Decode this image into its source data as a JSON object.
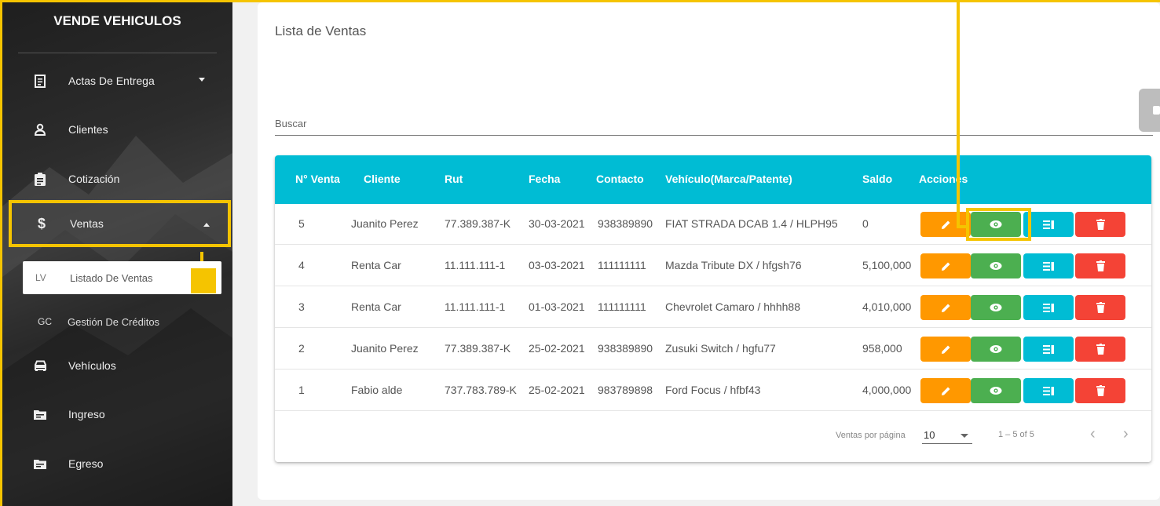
{
  "sidebar": {
    "brand": "VENDE VEHICULOS",
    "items": [
      {
        "label": "Actas De Entrega",
        "icon": "document-icon"
      },
      {
        "label": "Clientes",
        "icon": "person-icon"
      },
      {
        "label": "Cotización",
        "icon": "clipboard-icon"
      },
      {
        "label": "Ventas",
        "icon": "dollar-icon"
      },
      {
        "label": "Vehículos",
        "icon": "car-icon"
      },
      {
        "label": "Ingreso",
        "icon": "folder-icon"
      },
      {
        "label": "Egreso",
        "icon": "folder-icon"
      }
    ],
    "ventas_symbol": "$",
    "subitems": [
      {
        "abbr": "LV",
        "label": "Listado De Ventas"
      },
      {
        "abbr": "GC",
        "label": "Gestión De Créditos"
      }
    ]
  },
  "main": {
    "title": "Lista de Ventas",
    "search_label": "Buscar"
  },
  "table": {
    "headers": [
      "N° Venta",
      "Cliente",
      "Rut",
      "Fecha",
      "Contacto",
      "Vehículo(Marca/Patente)",
      "Saldo",
      "Acciones"
    ],
    "rows": [
      {
        "num": "5",
        "cliente": "Juanito Perez",
        "rut": "77.389.387-K",
        "fecha": "30-03-2021",
        "contacto": "938389890",
        "vehiculo": "FIAT STRADA DCAB 1.4 / HLPH95",
        "saldo": "0"
      },
      {
        "num": "4",
        "cliente": "Renta Car",
        "rut": "11.111.111-1",
        "fecha": "03-03-2021",
        "contacto": "111111111",
        "vehiculo": "Mazda Tribute DX / hfgsh76",
        "saldo": "5,100,000"
      },
      {
        "num": "3",
        "cliente": "Renta Car",
        "rut": "11.111.111-1",
        "fecha": "01-03-2021",
        "contacto": "111111111",
        "vehiculo": "Chevrolet Camaro / hhhh88",
        "saldo": "4,010,000"
      },
      {
        "num": "2",
        "cliente": "Juanito Perez",
        "rut": "77.389.387-K",
        "fecha": "25-02-2021",
        "contacto": "938389890",
        "vehiculo": "Zusuki Switch / hgfu77",
        "saldo": "958,000"
      },
      {
        "num": "1",
        "cliente": "Fabio alde",
        "rut": "737.783.789-K",
        "fecha": "25-02-2021",
        "contacto": "983789898",
        "vehiculo": "Ford Focus / hfbf43",
        "saldo": "4,000,000"
      }
    ]
  },
  "pagination": {
    "rows_per_page_label": "Ventas por página",
    "rows_per_page_value": "10",
    "range": "1 – 5 of 5",
    "prev": "‹",
    "next": "›"
  },
  "colors": {
    "highlight": "#f5c400",
    "header": "#00bcd4",
    "edit": "#ff9800",
    "view": "#4caf50",
    "list": "#00bcd4",
    "delete": "#f44336"
  }
}
